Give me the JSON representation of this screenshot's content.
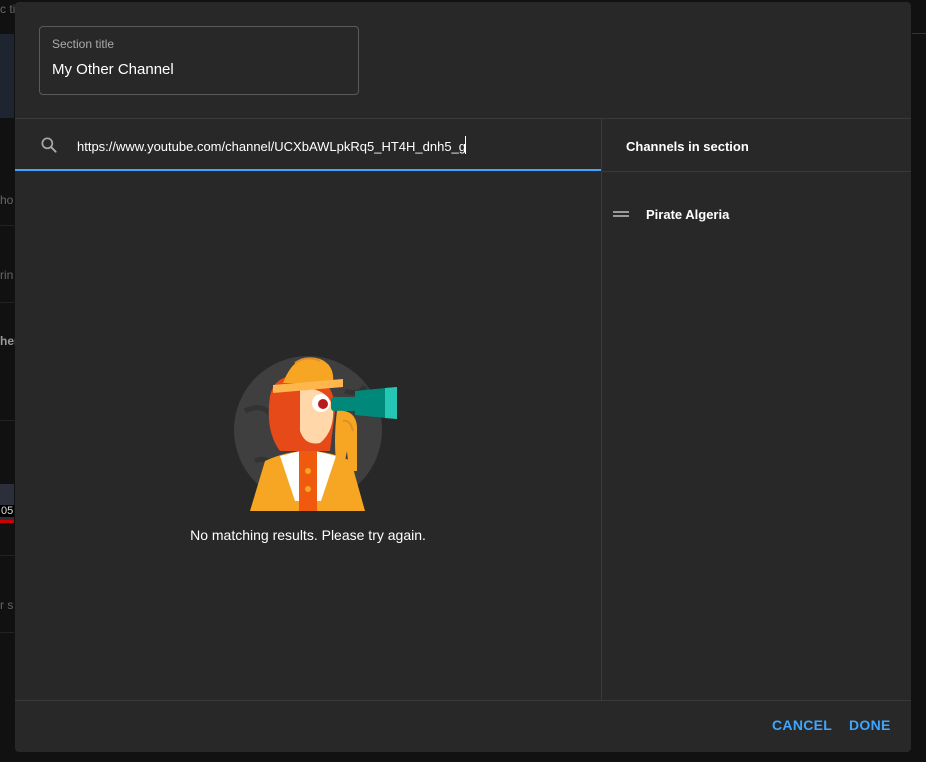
{
  "background": {
    "fragments": [
      "c ti",
      "ho",
      "rin",
      "her",
      "05",
      "r s"
    ]
  },
  "dialog": {
    "section_title": {
      "label": "Section title",
      "value": "My Other Channel"
    },
    "search": {
      "icon": "search-icon",
      "value": "https://www.youtube.com/channel/UCXbAWLpkRq5_HT4H_dnh5_g"
    },
    "empty_state": {
      "illustration": "explorer-with-binoculars",
      "message": "No matching results. Please try again."
    },
    "channels_panel": {
      "heading": "Channels in section",
      "items": [
        {
          "name": "Pirate Algeria",
          "icon": "drag-handle-icon"
        }
      ]
    },
    "footer": {
      "cancel_label": "CANCEL",
      "done_label": "DONE"
    }
  },
  "colors": {
    "accent": "#3ea6ff",
    "dialog_bg": "#282828",
    "page_bg": "#0f0f0f",
    "divider": "#3a3a3a"
  }
}
